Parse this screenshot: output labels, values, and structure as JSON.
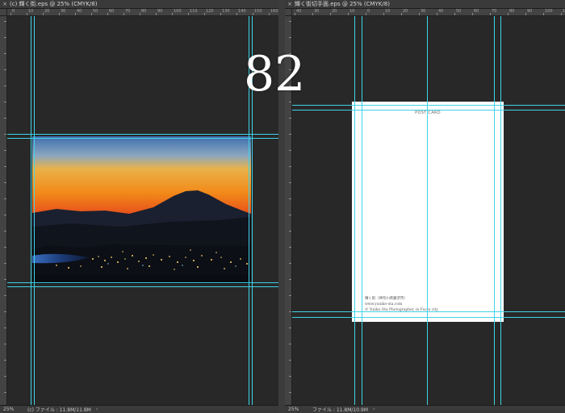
{
  "left_document": {
    "tab_title": "(c) 輝く街.eps @ 25% (CMYK/8)",
    "zoom": "25%",
    "file_info": "(c) ファイル : 11.8M/11.8M",
    "ruler_labels": [
      "0",
      "10",
      "20",
      "30",
      "40",
      "50",
      "60",
      "70",
      "80",
      "90",
      "100",
      "110",
      "120",
      "130",
      "140",
      "150",
      "160"
    ]
  },
  "right_document": {
    "tab_title": "輝く街切手面.eps @ 25% (CMYK/8)",
    "zoom": "25%",
    "file_info": "ファイル : 11.8M/10.9M",
    "ruler_labels": [
      "40",
      "30",
      "20",
      "10",
      "0",
      "10",
      "20",
      "30",
      "40",
      "50",
      "60",
      "70",
      "80",
      "90",
      "100",
      "110"
    ],
    "postcard": {
      "title": "POST CARD",
      "credit_lines": [
        "輝く街（神奈川県藤沢市）",
        "www.yuuiko-ota.com",
        "© Yuiiko Ota Photographer, in Fuchi city"
      ]
    }
  },
  "page_number": "82",
  "close_icon": "×",
  "arrow_icon": "›",
  "colors": {
    "guide": "#3fd3e6",
    "workspace": "#282828",
    "ruler": "#434343"
  }
}
